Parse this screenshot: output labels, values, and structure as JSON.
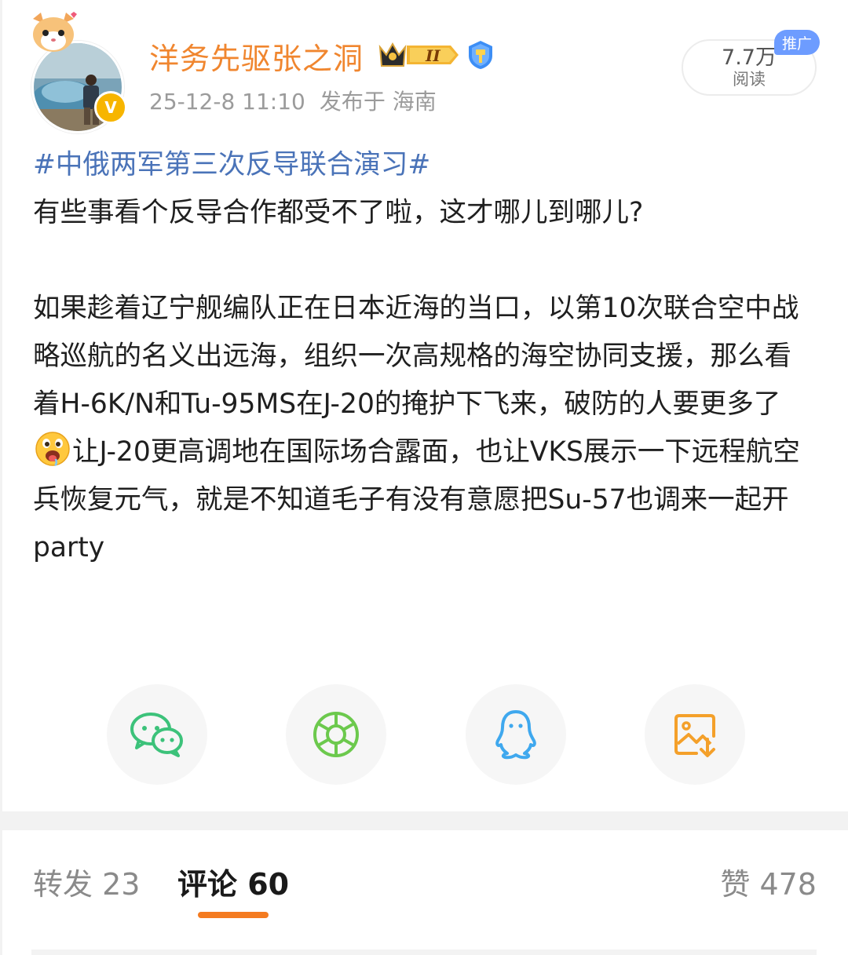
{
  "header": {
    "username": "洋务先驱张之洞",
    "level_badge": "II",
    "timestamp": "25-12-8 11:10",
    "location": "发布于 海南",
    "views_count": "7.7万",
    "views_label": "阅读",
    "promo_label": "推广"
  },
  "post": {
    "topic": "#中俄两军第三次反导联合演习#",
    "line1": "有些事看个反导合作都受不了啦，这才哪儿到哪儿?",
    "para2_part1": "如果趁着辽宁舰编队正在日本近海的当口，以第10次联合空中战略巡航的名义出远海，组织一次高规格的海空协同支援，那么看着H-6K/N和Tu-95MS在J-20的掩护下飞来，破防的人要更多了",
    "para2_part2": "让J-20更高调地在国际场合露面，也让VKS展示一下远程航空兵恢复元气，就是不知道毛子有没有意愿把Su-57也调来一起开party",
    "emoji": "drooling-face"
  },
  "share": {
    "buttons": [
      "wechat-icon",
      "moments-icon",
      "qq-icon",
      "save-image-icon"
    ]
  },
  "tabs": {
    "repost": "转发 23",
    "comments": "评论 60",
    "likes": "赞 478"
  },
  "colors": {
    "username": "#f0862f",
    "topic": "#4a73b8",
    "tab_underline": "#f47b20"
  }
}
